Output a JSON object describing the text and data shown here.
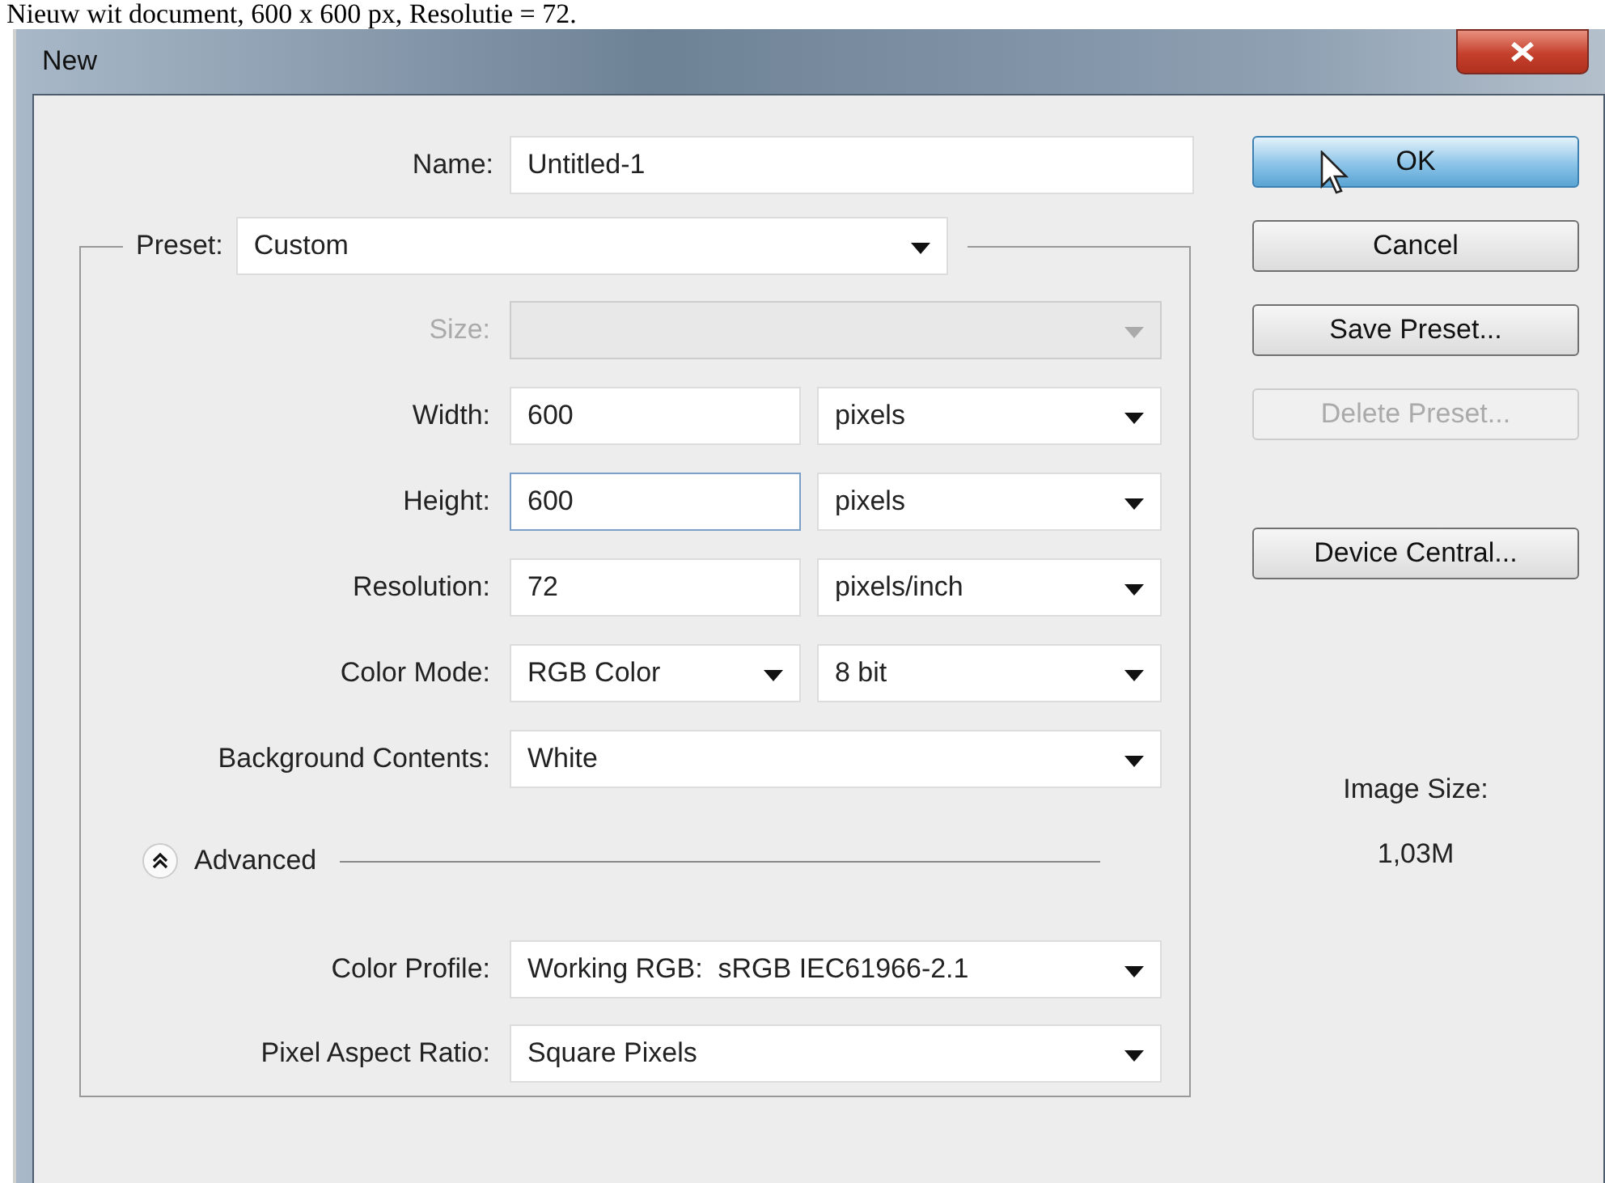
{
  "caption": "Nieuw wit document, 600 x 600 px, Resolutie = 72.",
  "window": {
    "title": "New"
  },
  "name": {
    "label": "Name:",
    "value": "Untitled-1"
  },
  "preset": {
    "label": "Preset:",
    "value": "Custom"
  },
  "rows": [
    {
      "label": "Size:",
      "kind": "select",
      "disabled": true
    },
    {
      "label": "Width:",
      "kind": "input",
      "value": "600",
      "focused": false,
      "unit": "pixels"
    },
    {
      "label": "Height:",
      "kind": "input",
      "value": "600",
      "focused": true,
      "unit": "pixels"
    },
    {
      "label": "Resolution:",
      "kind": "input",
      "value": "72",
      "focused": false,
      "unit": "pixels/inch"
    },
    {
      "label": "Color Mode:",
      "kind": "select",
      "value": "RGB Color",
      "disabled": false,
      "unit": "8 bit"
    },
    {
      "label": "Background Contents:",
      "kind": "select",
      "value": "White",
      "disabled": false
    }
  ],
  "advanced": {
    "label": "Advanced",
    "expanded": true
  },
  "advanced_rows": [
    {
      "label": "Color Profile:",
      "kind": "select",
      "value": "Working RGB:  sRGB IEC61966-2.1",
      "disabled": false
    },
    {
      "label": "Pixel Aspect Ratio:",
      "kind": "select",
      "value": "Square Pixels",
      "disabled": false
    }
  ],
  "buttons": [
    {
      "label": "OK",
      "default": true,
      "disabled": false
    },
    {
      "label": "Cancel",
      "default": false,
      "disabled": false
    },
    {
      "label": "Save Preset...",
      "default": false,
      "disabled": false
    },
    {
      "label": "Delete Preset...",
      "default": false,
      "disabled": true
    },
    {
      "label": "Device Central...",
      "default": false,
      "disabled": false
    }
  ],
  "image_size": {
    "label": "Image Size:",
    "value": "1,03M"
  }
}
